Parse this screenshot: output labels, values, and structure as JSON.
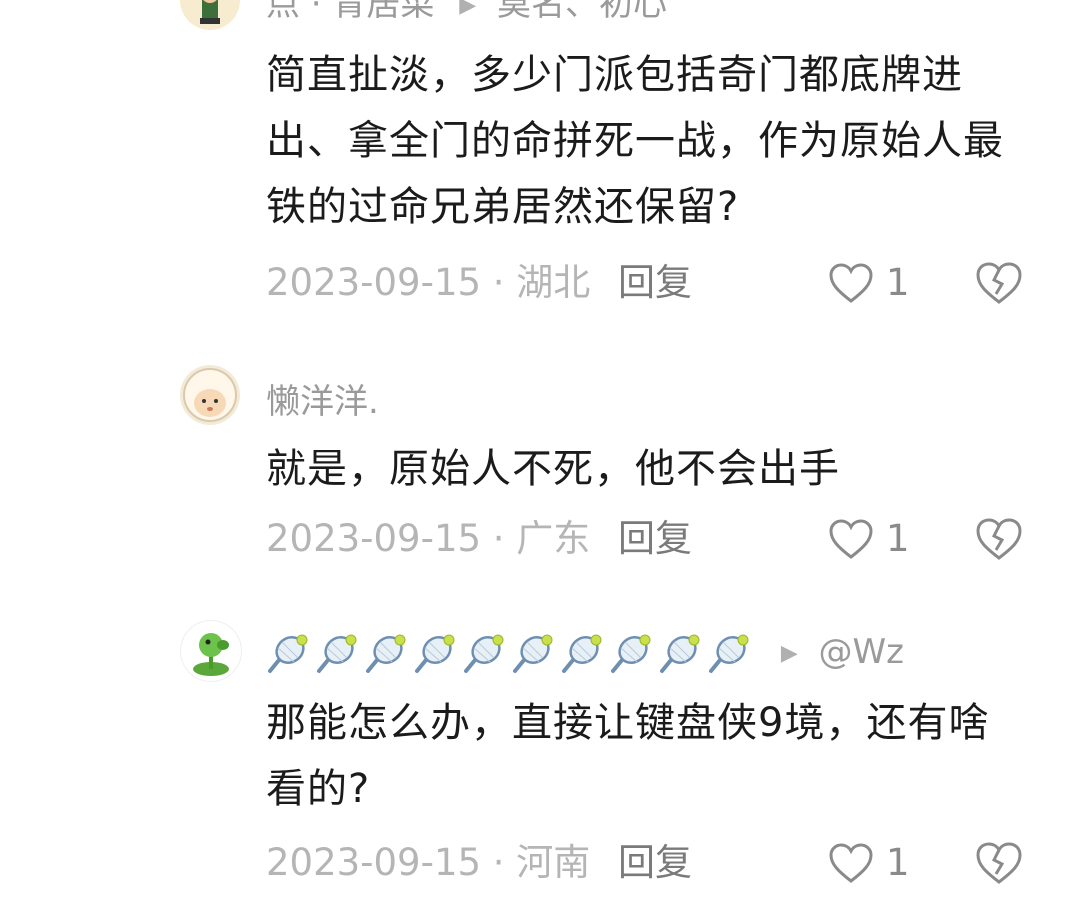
{
  "comments": [
    {
      "name": "点 · 青居菜",
      "reply_to": "莫名、初心",
      "text": "简直扯淡，多少门派包括奇门都底牌进出、拿全门的命拼死一战，作为原始人最铁的过命兄弟居然还保留?",
      "date_location": "2023-09-15 · 湖北",
      "reply_label": "回复",
      "likes": "1"
    },
    {
      "name": "懒洋洋.",
      "text": "就是，原始人不死，他不会出手",
      "date_location": "2023-09-15 · 广东",
      "reply_label": "回复",
      "likes": "1"
    },
    {
      "name_emoji_count": 10,
      "reply_to": "@Wz",
      "text": "那能怎么办，直接让键盘侠9境，还有啥看的?",
      "date_location": "2023-09-15 · 河南",
      "reply_label": "回复",
      "likes": "1"
    }
  ],
  "icons": {
    "like": "heart-outline-icon",
    "dislike": "broken-heart-icon",
    "reply_arrow": "triangle-right-icon"
  },
  "colors": {
    "text": "#1b1b1b",
    "meta": "#b5b5b5",
    "name": "#9a9a9a"
  }
}
